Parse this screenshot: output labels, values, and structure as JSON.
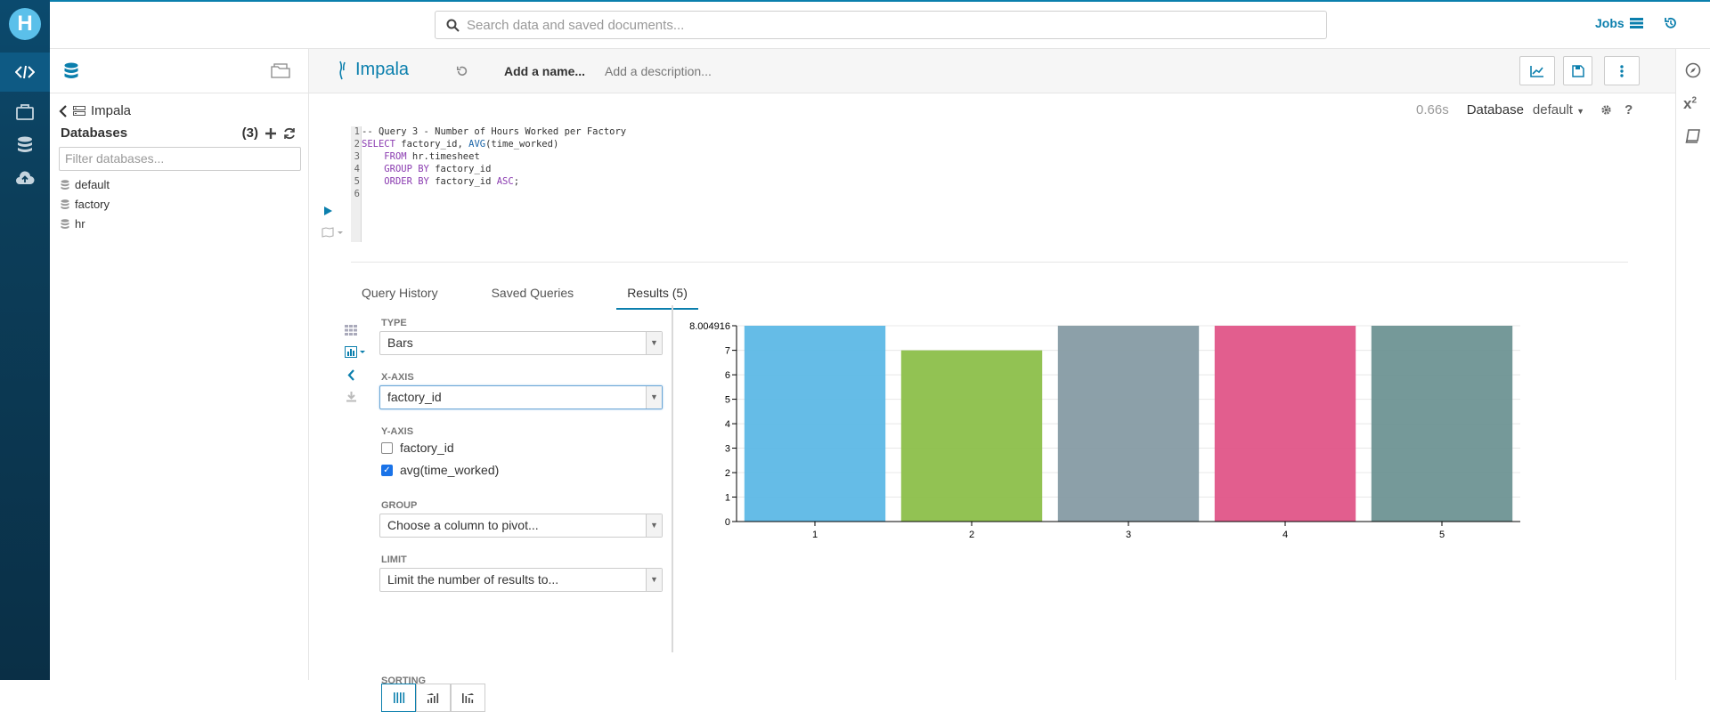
{
  "app": {
    "logo_letter": "H",
    "search_placeholder": "Search data and saved documents...",
    "jobs_label": "Jobs"
  },
  "assist": {
    "breadcrumb": "Impala",
    "databases_title": "Databases",
    "databases_count": "(3)",
    "filter_placeholder": "Filter databases...",
    "databases": [
      "default",
      "factory",
      "hr"
    ]
  },
  "snippet": {
    "engine": "Impala",
    "add_name": "Add a name...",
    "add_description": "Add a description...",
    "exec_time": "0.66s",
    "database_label": "Database",
    "database_value": "default"
  },
  "code_lines": [
    {
      "n": "1"
    },
    {
      "n": "2"
    },
    {
      "n": "3"
    },
    {
      "n": "4"
    },
    {
      "n": "5"
    },
    {
      "n": "6"
    }
  ],
  "code": {
    "l1": "-- Query 3 - Number of Hours Worked per Factory",
    "l2a": "SELECT",
    "l2b": " factory_id, ",
    "l2c": "AVG",
    "l2d": "(time_worked)",
    "l3a": "FROM",
    "l3b": " hr.timesheet",
    "l4a": "GROUP BY",
    "l4b": " factory_id",
    "l5a": "ORDER BY",
    "l5b": " factory_id ",
    "l5c": "ASC",
    "l5d": ";"
  },
  "tabs": {
    "history": "Query History",
    "saved": "Saved Queries",
    "results": "Results (5)"
  },
  "settings": {
    "type_label": "TYPE",
    "type_value": "Bars",
    "xaxis_label": "X-AXIS",
    "xaxis_value": "factory_id",
    "yaxis_label": "Y-AXIS",
    "y_options": [
      {
        "label": "factory_id",
        "checked": false
      },
      {
        "label": "avg(time_worked)",
        "checked": true
      }
    ],
    "group_label": "GROUP",
    "group_placeholder": "Choose a column to pivot...",
    "limit_label": "LIMIT",
    "limit_placeholder": "Limit the number of results to...",
    "sorting_label": "SORTING"
  },
  "colors": {
    "accent": "#0B7FAD"
  },
  "chart_data": {
    "type": "bar",
    "categories": [
      "1",
      "2",
      "3",
      "4",
      "5"
    ],
    "values": [
      8.004916,
      7.0,
      8.004916,
      8.004916,
      8.004916
    ],
    "colors": [
      "#5db8e6",
      "#8cbf4a",
      "#869ba4",
      "#e05588",
      "#6e9394"
    ],
    "ylim": [
      0,
      8.004916
    ],
    "yticks": [
      "0",
      "1",
      "2",
      "3",
      "4",
      "5",
      "6",
      "7",
      "8.004916"
    ],
    "grid": true,
    "title": "",
    "xlabel": "",
    "ylabel": ""
  }
}
